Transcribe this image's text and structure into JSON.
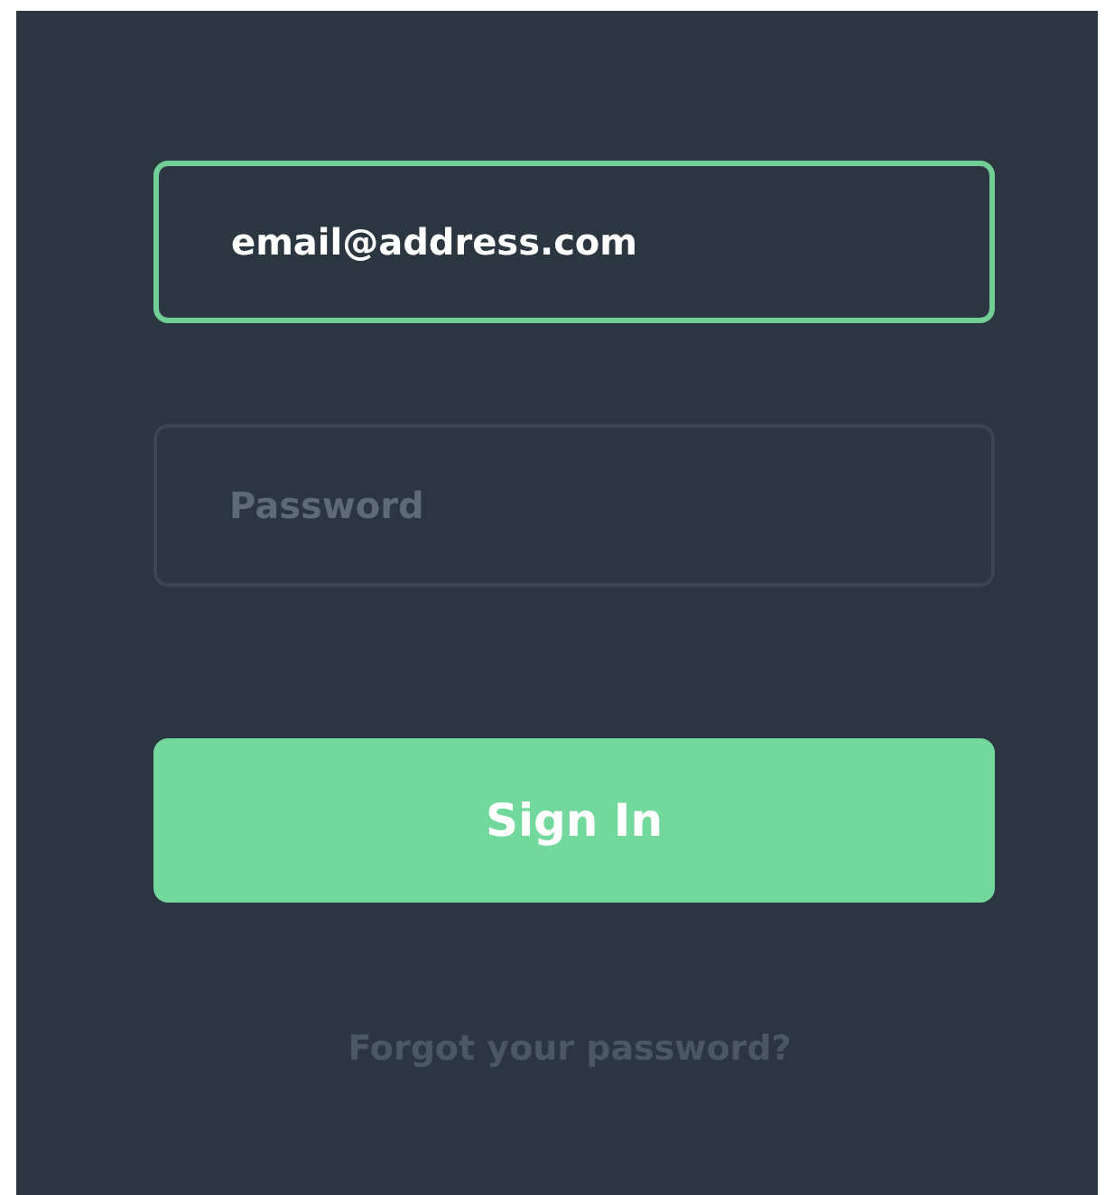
{
  "fields": [
    {
      "kind": "email",
      "value": "email@address.com",
      "focused": true
    },
    {
      "kind": "password",
      "placeholder": "Password",
      "focused": false
    }
  ],
  "button": {
    "label": "Sign In"
  },
  "forgot_link": {
    "label": "Forgot your password?"
  }
}
